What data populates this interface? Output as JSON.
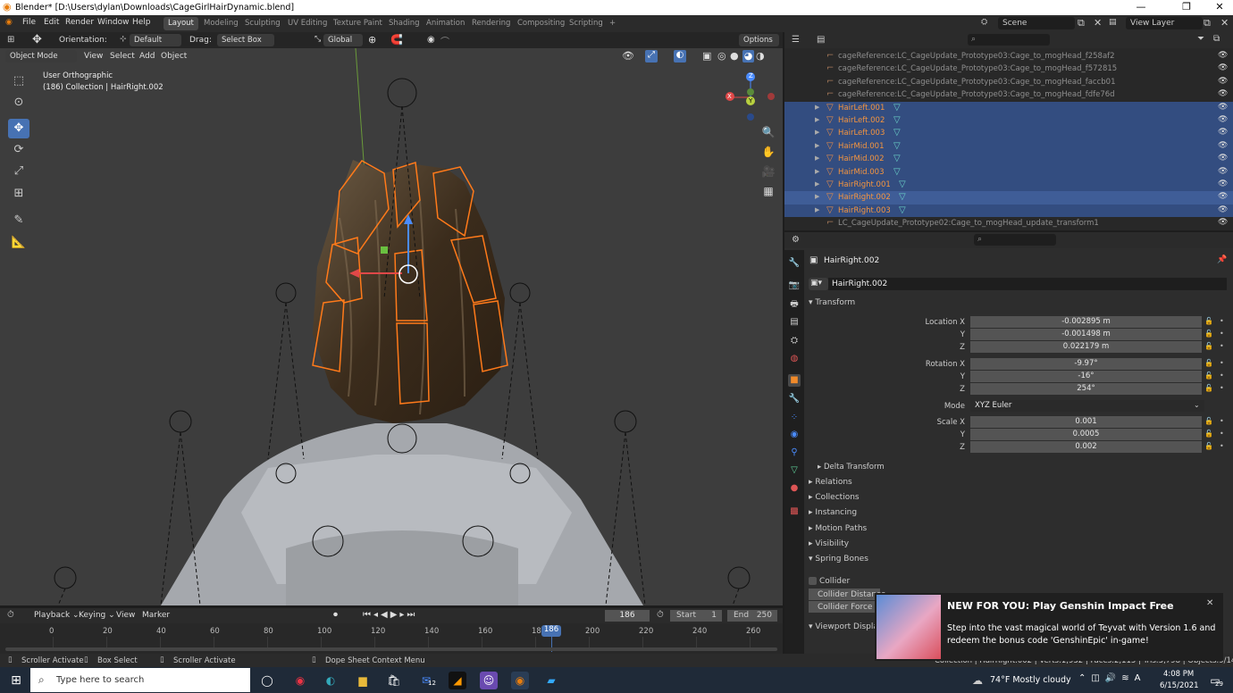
{
  "titlebar": {
    "title": "Blender* [D:\\Users\\dylan\\Downloads\\CageGirlHairDynamic.blend]",
    "minimize": "—",
    "maximize": "❐",
    "close": "✕"
  },
  "menu": {
    "items": [
      "File",
      "Edit",
      "Render",
      "Window",
      "Help"
    ]
  },
  "workspaces": {
    "tabs": [
      "Layout",
      "Modeling",
      "Sculpting",
      "UV Editing",
      "Texture Paint",
      "Shading",
      "Animation",
      "Rendering",
      "Compositing",
      "Scripting"
    ],
    "add": "+"
  },
  "scene": {
    "name": "Scene",
    "view_layer": "View Layer"
  },
  "viewport_header": {
    "orientation_label": "Orientation:",
    "orientation_value": "Default",
    "drag_label": "Drag:",
    "drag_value": "Select Box",
    "transform_space": "Global",
    "options": "Options"
  },
  "viewport_header2": {
    "mode": "Object Mode",
    "view": "View",
    "select": "Select",
    "add": "Add",
    "object": "Object"
  },
  "viewport": {
    "view_name": "User Orthographic",
    "collection_info": "(186) Collection | HairRight.002",
    "axis_x": "X",
    "axis_y": "Y",
    "axis_z": "Z"
  },
  "outliner": {
    "rows": [
      {
        "name": "cageReference:LC_CageUpdate_Prototype03:Cage_to_mogHead_f258af2",
        "type": "ref"
      },
      {
        "name": "cageReference:LC_CageUpdate_Prototype03:Cage_to_mogHead_f572815",
        "type": "ref"
      },
      {
        "name": "cageReference:LC_CageUpdate_Prototype03:Cage_to_mogHead_faccb01",
        "type": "ref"
      },
      {
        "name": "cageReference:LC_CageUpdate_Prototype03:Cage_to_mogHead_fdfe76d",
        "type": "ref"
      },
      {
        "name": "HairLeft.001",
        "type": "sel"
      },
      {
        "name": "HairLeft.002",
        "type": "sel"
      },
      {
        "name": "HairLeft.003",
        "type": "sel"
      },
      {
        "name": "HairMid.001",
        "type": "sel"
      },
      {
        "name": "HairMid.002",
        "type": "sel"
      },
      {
        "name": "HairMid.003",
        "type": "sel"
      },
      {
        "name": "HairRight.001",
        "type": "sel"
      },
      {
        "name": "HairRight.002",
        "type": "active"
      },
      {
        "name": "HairRight.003",
        "type": "sel"
      },
      {
        "name": "LC_CageUpdate_Prototype02:Cage_to_mogHead_update_transform1",
        "type": "ref"
      }
    ]
  },
  "properties": {
    "object_name": "HairRight.002",
    "object_field": "HairRight.002",
    "transform_header": "Transform",
    "location": {
      "label": "Location X",
      "x": "-0.002895 m",
      "y": "-0.001498 m",
      "z": "0.022179 m"
    },
    "rotation": {
      "label": "Rotation X",
      "x": "-9.97°",
      "y": "-16°",
      "z": "254°"
    },
    "mode": {
      "label": "Mode",
      "value": "XYZ Euler"
    },
    "scale": {
      "label": "Scale X",
      "x": "0.001",
      "y": "0.0005",
      "z": "0.002"
    },
    "axis_y": "Y",
    "axis_z": "Z",
    "panels": [
      "Delta Transform",
      "Relations",
      "Collections",
      "Instancing",
      "Motion Paths",
      "Visibility",
      "Spring Bones"
    ],
    "collider": "Collider",
    "collider_distance": "Collider Distance",
    "collider_force": "Collider Force",
    "viewport_display": "Viewport Display"
  },
  "timeline": {
    "playback": "Playback",
    "keying": "Keying",
    "view": "View",
    "marker": "Marker",
    "current_frame": "186",
    "start_label": "Start",
    "start": "1",
    "end_label": "End",
    "end": "250",
    "ticks": [
      "0",
      "20",
      "40",
      "60",
      "80",
      "100",
      "120",
      "140",
      "160",
      "180",
      "200",
      "220",
      "240",
      "260"
    ],
    "playhead": "186"
  },
  "statusbar": {
    "items": [
      "Scroller Activate",
      "Box Select",
      "Scroller Activate",
      "Dope Sheet Context Menu"
    ],
    "info": "Collection | HairRight.002 | Verts:1,932 | Faces:2,115 | Tris:3,798 | Objects:9/14 | 2.91.0"
  },
  "taskbar": {
    "search_placeholder": "Type here to search",
    "weather": "74°F  Mostly cloudy",
    "time": "4:08 PM",
    "date": "6/15/2021",
    "mail_badge": "12",
    "notif_badge": "29"
  },
  "toast": {
    "title": "NEW FOR YOU: Play Genshin Impact Free",
    "body": "Step into the vast magical world of Teyvat with Version 1.6 and redeem the bonus code 'GenshinEpic' in-game!",
    "close": "✕"
  }
}
